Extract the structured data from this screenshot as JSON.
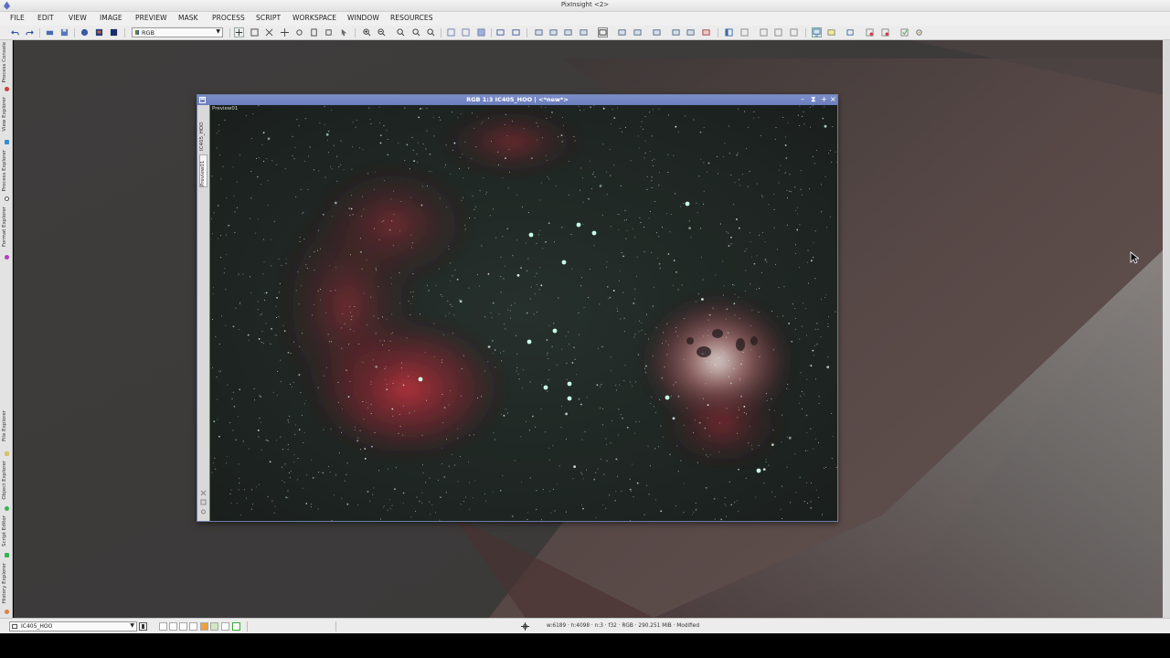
{
  "window": {
    "title": "PixInsight <2>"
  },
  "menu": [
    "FILE",
    "EDIT",
    "VIEW",
    "IMAGE",
    "PREVIEW",
    "MASK",
    "PROCESS",
    "SCRIPT",
    "WORKSPACE",
    "WINDOW",
    "RESOURCES"
  ],
  "toolbar": {
    "colorspace_value": "RGB"
  },
  "sidebar": {
    "tabs": [
      "Process Console",
      "View Explorer",
      "Process Explorer",
      "Format Explorer",
      "File Explorer",
      "Object Explorer",
      "Script Editor",
      "History Explorer"
    ]
  },
  "image_window": {
    "title": "RGB 1:3 IC405_HOO | <*new*>",
    "tabs": [
      "IC405_HOO",
      "Preview01"
    ],
    "preview_label": "Preview01",
    "controls": [
      "–",
      "⧗",
      "+",
      "×"
    ]
  },
  "statusbar": {
    "view_value": "IC405_HOO",
    "info": "w:6189 · h:4098 · n:3 · f32 · RGB · 290.251 MiB · Modified"
  },
  "colors": {
    "window_title": "#7080c0",
    "workspace": "#3d3b3b",
    "nebula_red": "#b02c3a"
  }
}
